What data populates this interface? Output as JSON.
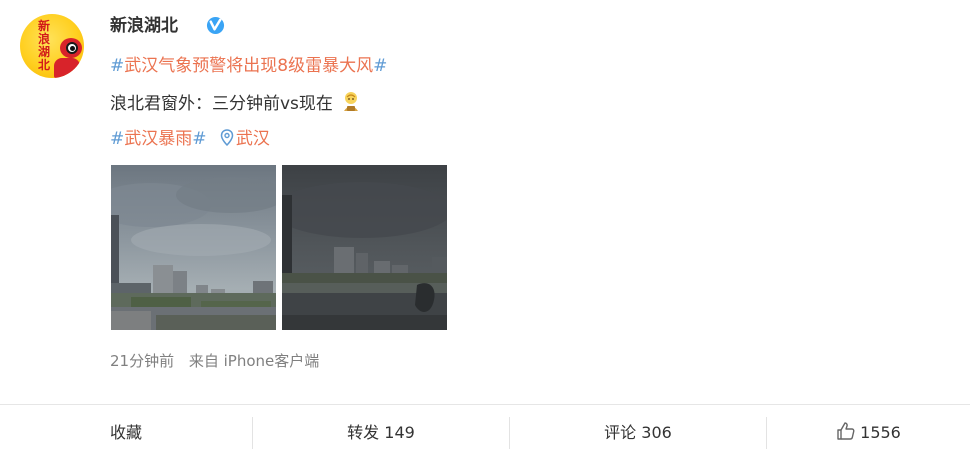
{
  "user": {
    "name": "新浪湖北",
    "avatar_chars": [
      "新",
      "浪",
      "湖",
      "北"
    ],
    "verified": true,
    "avatar_icon": "sina-weibo-eye-logo"
  },
  "post": {
    "topic_prefix": "#",
    "topic_text": "武汉气象预警将出现8级雷暴大风",
    "topic_suffix": "#",
    "body_text": "浪北君窗外：三分钟前vs现在",
    "body_emoji": "emoji-face",
    "tag_prefix": "#",
    "tag_text": "武汉暴雨",
    "tag_suffix": "#",
    "location_icon": "location-pin-icon",
    "location_text": "武汉",
    "photos": [
      {
        "icon": "sky-photo-cloudy-lighter",
        "kind": "photo"
      },
      {
        "icon": "sky-photo-storm-darker",
        "kind": "photo"
      }
    ],
    "time": "21分钟前",
    "source": "来自 iPhone客户端"
  },
  "actions": {
    "favorite_label": "收藏",
    "repost_label": "转发",
    "repost_count": "149",
    "comment_label": "评论",
    "comment_count": "306",
    "like_count": "1556",
    "like_icon": "thumbs-up-icon"
  },
  "colors": {
    "topic": "#eb7350",
    "hash": "#5f9bd4",
    "meta": "#808080",
    "verified_badge": "#3aa4f5"
  }
}
